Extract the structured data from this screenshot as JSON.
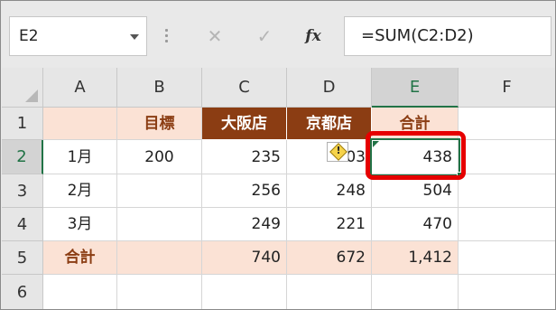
{
  "name_box": {
    "value": "E2"
  },
  "formula_bar": {
    "cancel_glyph": "✕",
    "enter_glyph": "✓",
    "fx_label": "fx",
    "formula": "=SUM(C2:D2)"
  },
  "columns": [
    "A",
    "B",
    "C",
    "D",
    "E",
    "F"
  ],
  "rows": [
    "1",
    "2",
    "3",
    "4",
    "5",
    "6"
  ],
  "table": {
    "header": {
      "a": "",
      "b": "目標",
      "c": "大阪店",
      "d": "京都店",
      "e": "合計"
    },
    "r2": {
      "a": "1月",
      "b": "200",
      "c": "235",
      "d": "03",
      "e": "438"
    },
    "r3": {
      "a": "2月",
      "b": "",
      "c": "256",
      "d": "248",
      "e": "504"
    },
    "r4": {
      "a": "3月",
      "b": "",
      "c": "249",
      "d": "221",
      "e": "470"
    },
    "r5": {
      "a": "合計",
      "b": "",
      "c": "740",
      "d": "672",
      "e": "1,412"
    }
  },
  "warning": {
    "glyph": "!",
    "icon": "error-warning-icon"
  },
  "colors": {
    "brown": "#8b3d13",
    "peach": "#fbe2d5",
    "excel_green": "#217346",
    "highlight": "#e60000"
  }
}
